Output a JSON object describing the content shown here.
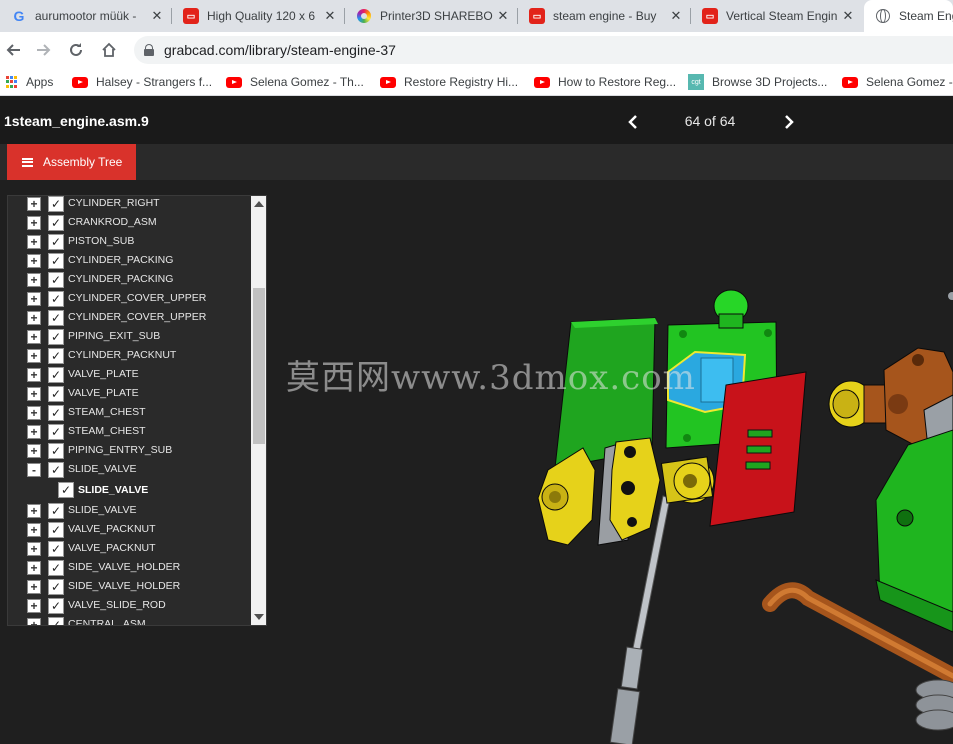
{
  "browser": {
    "tabs": [
      {
        "title": "aurumootor müük - ",
        "icon": "google-icon"
      },
      {
        "title": "High Quality 120 x 6",
        "icon": "aliexpress-icon"
      },
      {
        "title": "Printer3D SHAREBO",
        "icon": "printer3d-ring-icon"
      },
      {
        "title": "steam engine - Buy ",
        "icon": "aliexpress-icon"
      },
      {
        "title": "Vertical Steam Engin",
        "icon": "aliexpress-icon"
      },
      {
        "title": "Steam Eng",
        "icon": "globe-icon"
      }
    ],
    "url": "grabcad.com/library/steam-engine-37",
    "bookmarks": [
      {
        "label": "Apps",
        "icon": "apps-icon"
      },
      {
        "label": "Halsey - Strangers f...",
        "icon": "youtube-icon"
      },
      {
        "label": "Selena Gomez - Th...",
        "icon": "youtube-icon"
      },
      {
        "label": "Restore Registry Hi...",
        "icon": "youtube-icon"
      },
      {
        "label": "How to Restore Reg...",
        "icon": "youtube-icon"
      },
      {
        "label": "Browse 3D Projects...",
        "icon": "cgtrader-icon"
      },
      {
        "label": "Selena Gomez - ",
        "icon": "youtube-icon"
      }
    ]
  },
  "viewer": {
    "file_title": "1steam_engine.asm.9",
    "page_counter": "64 of 64",
    "assembly_tree_button": "Assembly Tree",
    "watermark": "莫西网www.3dmox.com"
  },
  "tree": [
    {
      "label": "CYLINDER_RIGHT",
      "expander": "+",
      "checked": true,
      "level": 0
    },
    {
      "label": "CRANKROD_ASM",
      "expander": "+",
      "checked": true,
      "level": 0
    },
    {
      "label": "PISTON_SUB",
      "expander": "+",
      "checked": true,
      "level": 0
    },
    {
      "label": "CYLINDER_PACKING",
      "expander": "+",
      "checked": true,
      "level": 0
    },
    {
      "label": "CYLINDER_PACKING",
      "expander": "+",
      "checked": true,
      "level": 0
    },
    {
      "label": "CYLINDER_COVER_UPPER",
      "expander": "+",
      "checked": true,
      "level": 0
    },
    {
      "label": "CYLINDER_COVER_UPPER",
      "expander": "+",
      "checked": true,
      "level": 0
    },
    {
      "label": "PIPING_EXIT_SUB",
      "expander": "+",
      "checked": true,
      "level": 0
    },
    {
      "label": "CYLINDER_PACKNUT",
      "expander": "+",
      "checked": true,
      "level": 0
    },
    {
      "label": "VALVE_PLATE",
      "expander": "+",
      "checked": true,
      "level": 0
    },
    {
      "label": "VALVE_PLATE",
      "expander": "+",
      "checked": true,
      "level": 0
    },
    {
      "label": "STEAM_CHEST",
      "expander": "+",
      "checked": true,
      "level": 0
    },
    {
      "label": "STEAM_CHEST",
      "expander": "+",
      "checked": true,
      "level": 0
    },
    {
      "label": "PIPING_ENTRY_SUB",
      "expander": "+",
      "checked": true,
      "level": 0
    },
    {
      "label": "SLIDE_VALVE",
      "expander": "-",
      "checked": true,
      "level": 0
    },
    {
      "label": "SLIDE_VALVE",
      "expander": "",
      "checked": true,
      "level": 1
    },
    {
      "label": "SLIDE_VALVE",
      "expander": "+",
      "checked": true,
      "level": 0
    },
    {
      "label": "VALVE_PACKNUT",
      "expander": "+",
      "checked": true,
      "level": 0
    },
    {
      "label": "VALVE_PACKNUT",
      "expander": "+",
      "checked": true,
      "level": 0
    },
    {
      "label": "SIDE_VALVE_HOLDER",
      "expander": "+",
      "checked": true,
      "level": 0
    },
    {
      "label": "SIDE_VALVE_HOLDER",
      "expander": "+",
      "checked": true,
      "level": 0
    },
    {
      "label": "VALVE_SLIDE_ROD",
      "expander": "+",
      "checked": true,
      "level": 0
    },
    {
      "label": "CENTRAL_ASM",
      "expander": "+",
      "checked": true,
      "level": 0
    }
  ],
  "colors": {
    "accent_red": "#d9322b",
    "model_green": "#1fbf1f",
    "model_yellow": "#e6d21a",
    "model_red": "#c8121a",
    "model_brown": "#a6551c",
    "selection_blue": "#2aa8e0"
  }
}
